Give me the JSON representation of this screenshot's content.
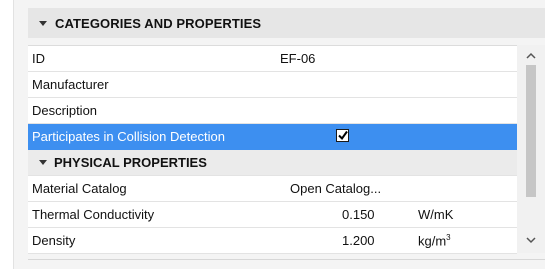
{
  "header": {
    "title": "CATEGORIES AND PROPERTIES",
    "expanded": true,
    "icon": "triangle-down-icon"
  },
  "rows": [
    {
      "label": "ID",
      "value": "EF-06"
    },
    {
      "label": "Manufacturer",
      "value": ""
    },
    {
      "label": "Description",
      "value": ""
    },
    {
      "label": "Participates in Collision Detection",
      "checked": true,
      "selected": true
    }
  ],
  "section": {
    "title": "PHYSICAL PROPERTIES",
    "expanded": true,
    "icon": "triangle-down-icon"
  },
  "physical": [
    {
      "label": "Material Catalog",
      "value": "Open Catalog...",
      "unit": ""
    },
    {
      "label": "Thermal Conductivity",
      "value": "0.150",
      "unit": "W/mK"
    },
    {
      "label": "Density",
      "value": "1.200",
      "unit_base": "kg/m",
      "unit_exp": "3"
    }
  ],
  "colors": {
    "selection": "#3d8ff0",
    "header_bg": "#e6e6e6",
    "section_bg": "#ebebeb"
  }
}
